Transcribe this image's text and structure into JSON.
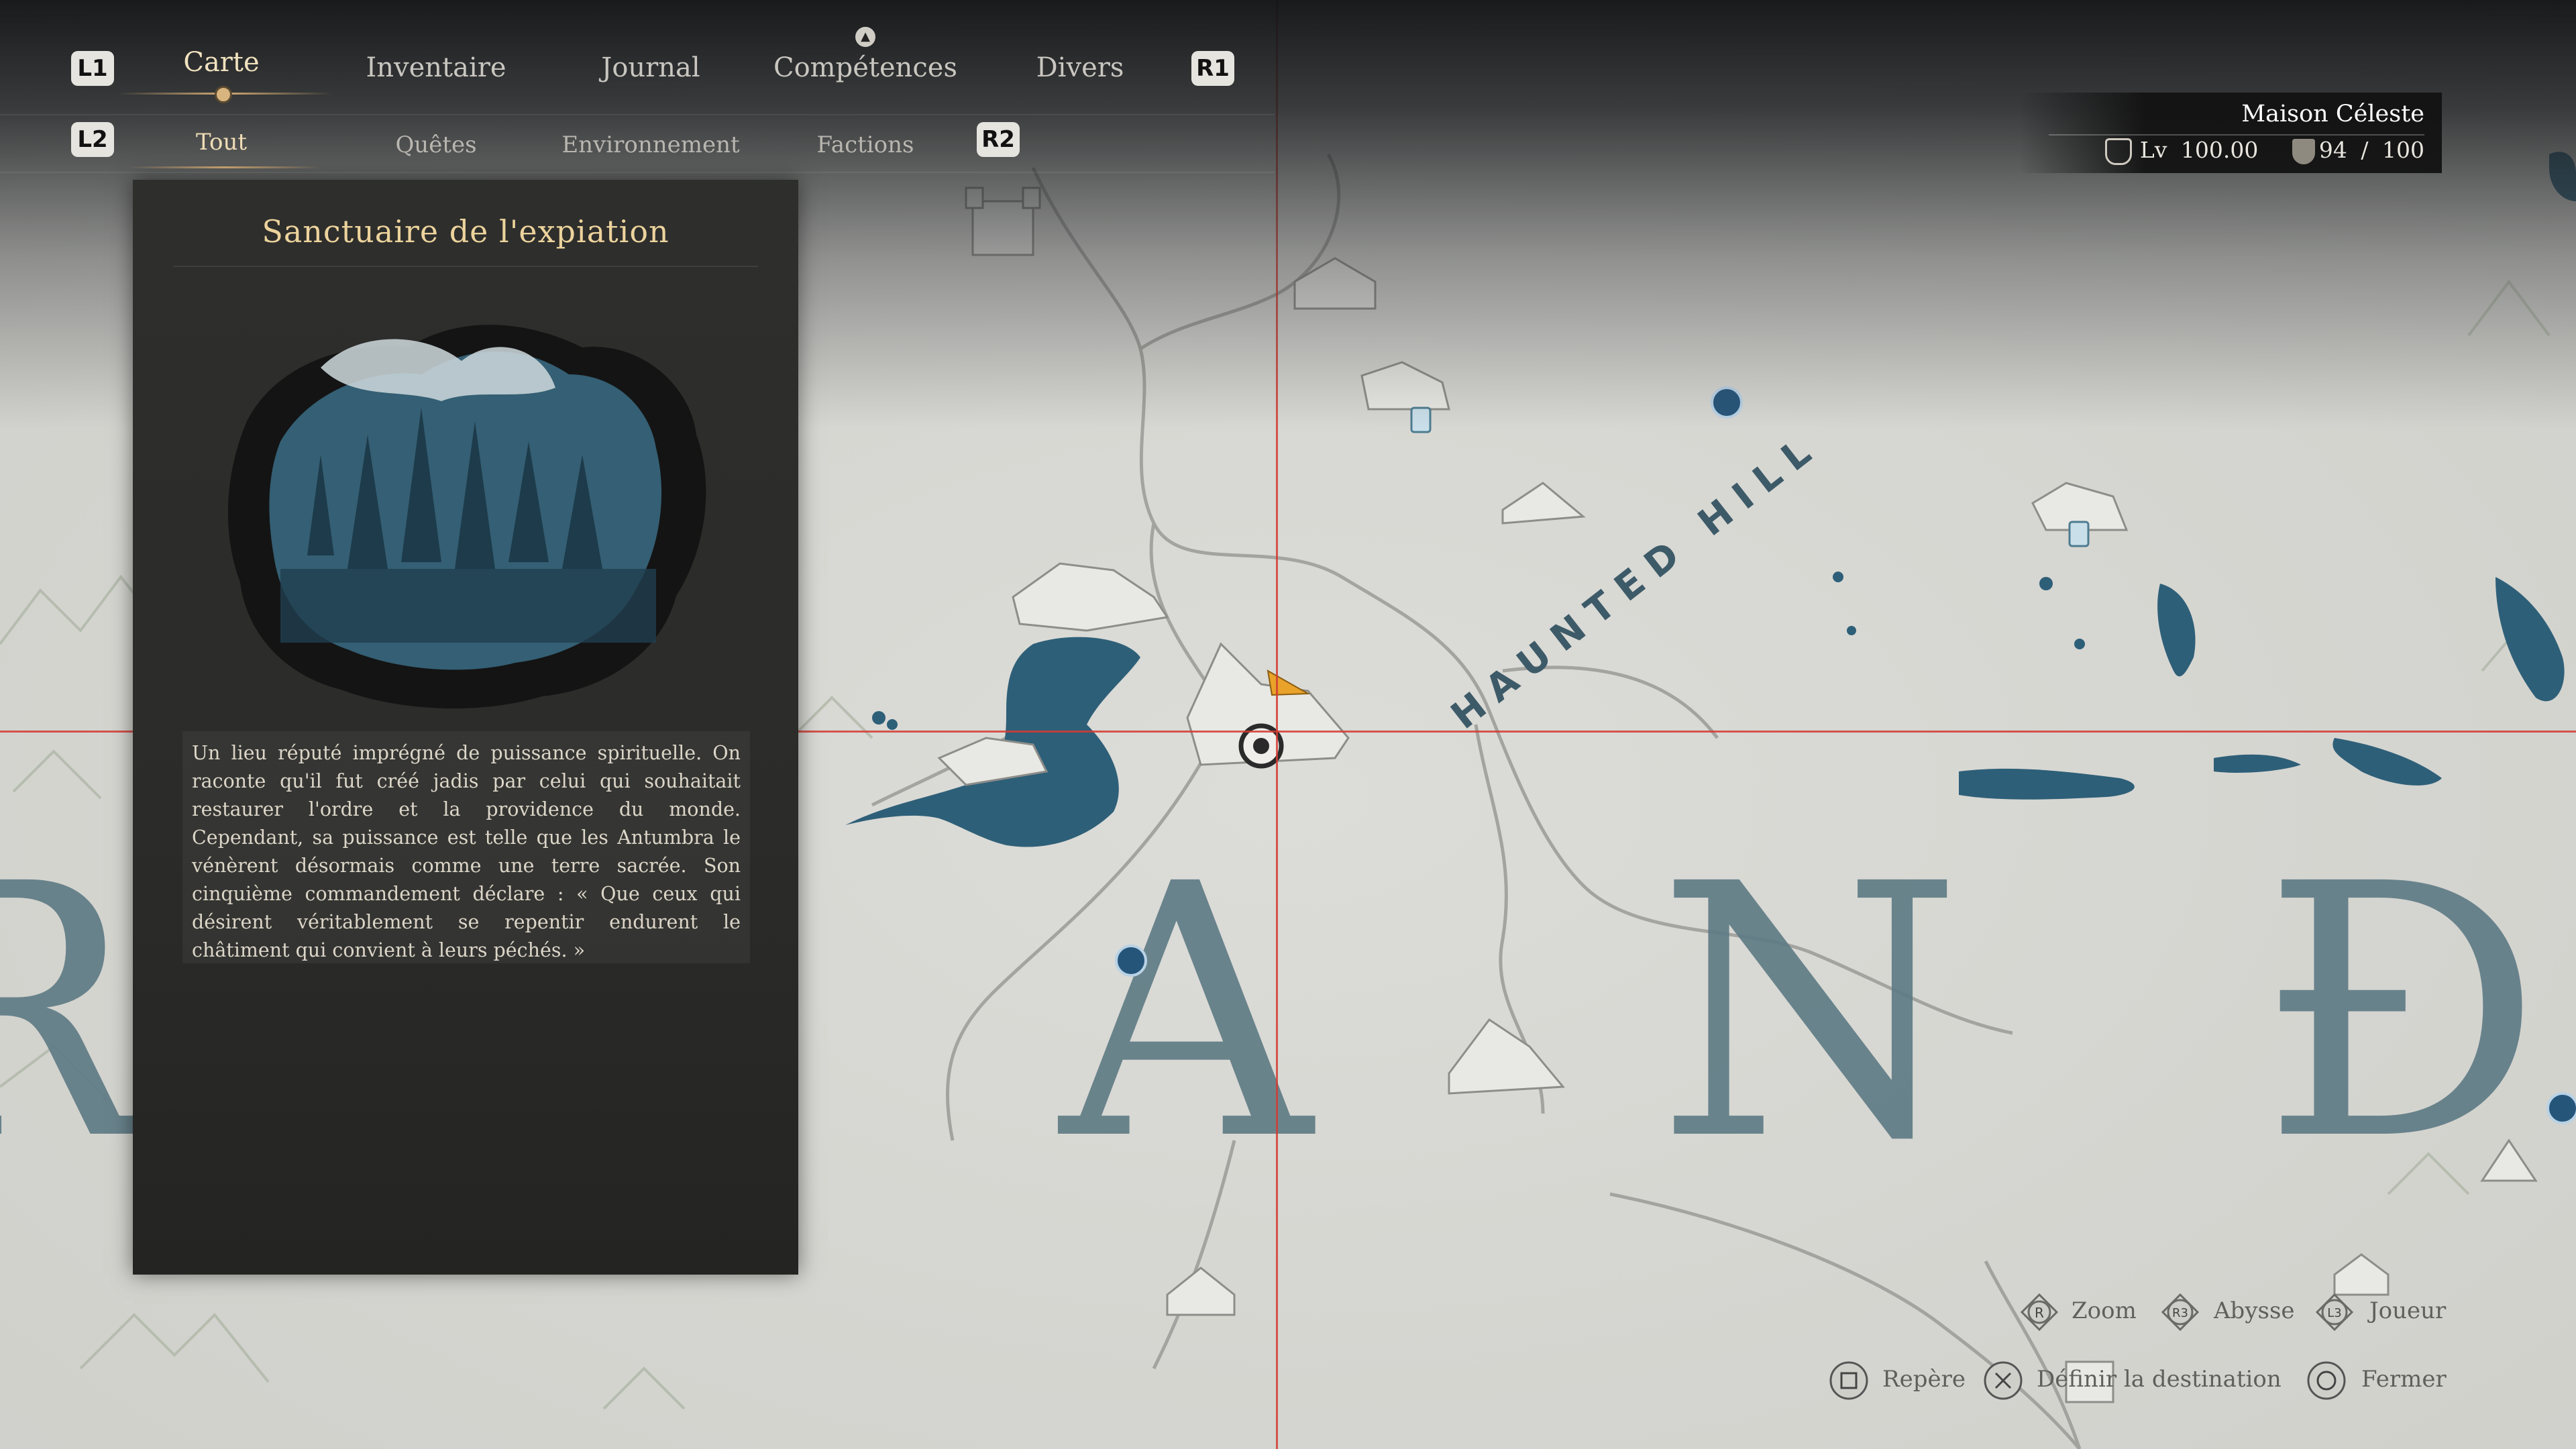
{
  "tabs": {
    "left_shoulder": "L1",
    "right_shoulder": "R1",
    "items": [
      {
        "label": "Carte",
        "active": true
      },
      {
        "label": "Inventaire",
        "active": false
      },
      {
        "label": "Journal",
        "active": false
      },
      {
        "label": "Compétences",
        "active": false
      },
      {
        "label": "Divers",
        "active": false
      }
    ]
  },
  "subtabs": {
    "left_trigger": "L2",
    "right_trigger": "R2",
    "items": [
      {
        "label": "Tout",
        "active": true
      },
      {
        "label": "Quêtes",
        "active": false
      },
      {
        "label": "Environnement",
        "active": false
      },
      {
        "label": "Factions",
        "active": false
      }
    ]
  },
  "location": {
    "title": "Sanctuaire de l'expiation",
    "description": "Un lieu réputé imprégné de puissance spirituelle. On raconte qu'il fut créé jadis par celui qui souhaitait restaurer l'ordre et la providence du monde. Cependant, sa puissance est telle que les Antumbra le vénèrent désormais comme une terre sacrée. Son cinquième commandement déclare : « Que ceux qui désirent véritablement se repentir endurent le châtiment qui convient à leurs péchés. »"
  },
  "player": {
    "name": "Maison  Céleste",
    "level_label": "Lv",
    "level": "100.00",
    "current": "94",
    "separator": "/",
    "max": "100"
  },
  "map": {
    "region_label": "HAUNTED HILL",
    "big_letters": [
      "R",
      "A",
      "N",
      "Đ"
    ],
    "colors": {
      "parchment": "#d6d6d2",
      "water": "#2e5f78",
      "crosshair": "#d23c32",
      "marker": "#e9a22a"
    }
  },
  "controls": {
    "zoom": {
      "button": "R",
      "label": "Zoom"
    },
    "abyss": {
      "button": "R3",
      "label": "Abysse"
    },
    "player": {
      "button": "L3",
      "label": "Joueur"
    },
    "marker": {
      "button": "square",
      "label": "Repère"
    },
    "destination": {
      "button": "cross",
      "label": "Définir  la  destination"
    },
    "close": {
      "button": "circle",
      "label": "Fermer"
    }
  }
}
